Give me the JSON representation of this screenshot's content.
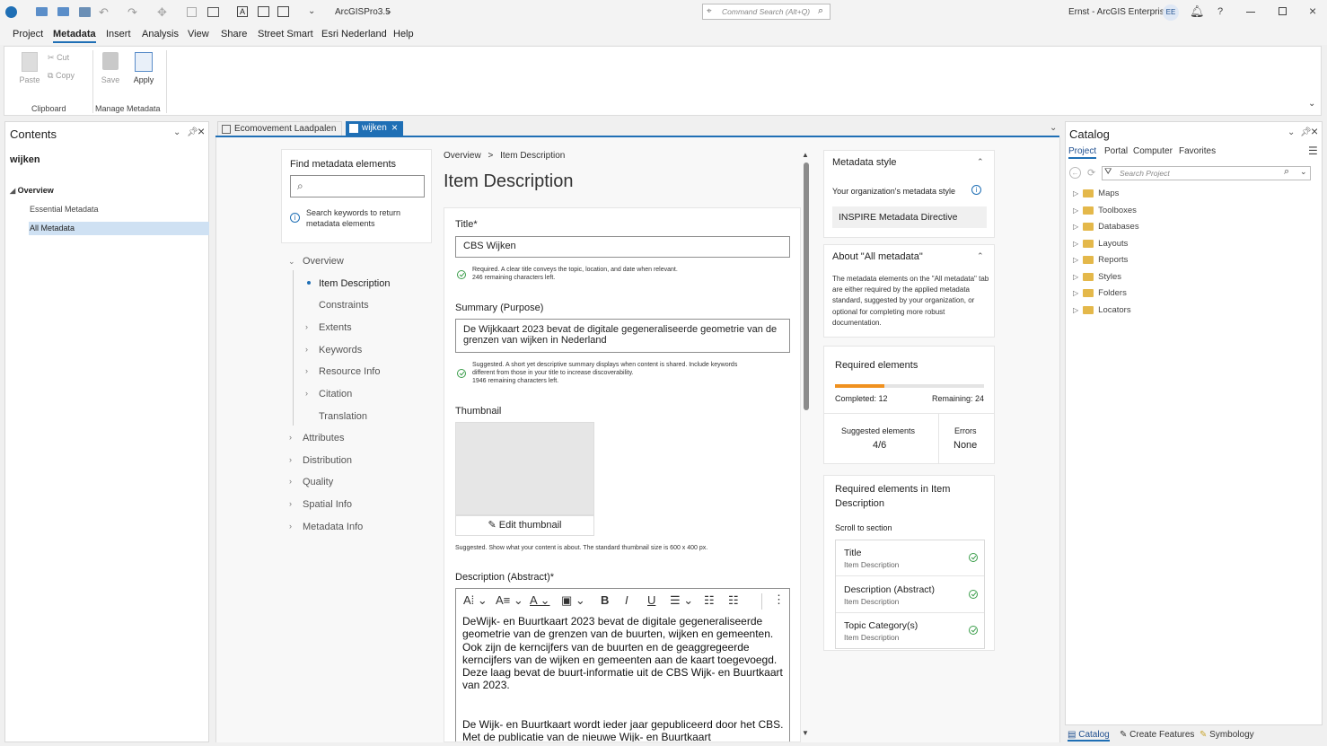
{
  "app": {
    "project_name": "ArcGISPro3.5",
    "command_search_placeholder": "Command Search (Alt+Q)",
    "user_portal": "Ernst - ArcGIS Enterprise",
    "user_initials": "EE",
    "help_symbol": "?"
  },
  "menu": [
    "Project",
    "Metadata",
    "Insert",
    "Analysis",
    "View",
    "Share",
    "Street Smart",
    "Esri Nederland",
    "Help"
  ],
  "ribbon": {
    "paste": "Paste",
    "cut": "Cut",
    "copy": "Copy",
    "clipboard_group": "Clipboard",
    "save": "Save",
    "apply": "Apply",
    "manage_group": "Manage Metadata"
  },
  "contents": {
    "title": "Contents",
    "layer": "wijken",
    "overview": "Overview",
    "essential": "Essential Metadata",
    "all": "All Metadata"
  },
  "tabs": [
    "Ecomovement Laadpalen",
    "wijken"
  ],
  "finder": {
    "title": "Find metadata elements",
    "search_hint": "Search keywords to return metadata elements"
  },
  "nav": {
    "overview": "Overview",
    "sub": [
      "Item Description",
      "Constraints",
      "Extents",
      "Keywords",
      "Resource Info",
      "Citation",
      "Translation"
    ],
    "top": [
      "Attributes",
      "Distribution",
      "Quality",
      "Spatial Info",
      "Metadata Info"
    ]
  },
  "breadcrumb": {
    "root": "Overview",
    "sep": ">",
    "current": "Item Description"
  },
  "page_title": "Item Description",
  "form": {
    "title_label": "Title*",
    "title_value": "CBS Wijken",
    "title_hint1": "Required. A clear title conveys the topic, location, and date when relevant.",
    "title_hint2": "246 remaining characters left.",
    "summary_label": "Summary (Purpose)",
    "summary_value": "De Wijkkaart 2023 bevat de digitale gegeneraliseerde geometrie van de grenzen van wijken  in Nederland",
    "summary_hint1": "Suggested. A short yet descriptive summary displays when content is shared. Include keywords",
    "summary_hint2": "different from those in your title to increase discoverability.",
    "summary_hint3": "1946 remaining characters left.",
    "thumbnail_label": "Thumbnail",
    "edit_thumbnail": "Edit thumbnail",
    "thumbnail_hint": "Suggested. Show what your content is about. The standard thumbnail size is 600 x 400 px.",
    "description_label": "Description (Abstract)*",
    "description_p1": "DeWijk- en Buurtkaart 2023 bevat de digitale gegeneraliseerde geometrie van de grenzen van de buurten, wijken en gemeenten. Ook zijn de kerncijfers van de buurten en de geaggregeerde kerncijfers van de wijken en gemeenten aan de kaart toegevoegd. Deze laag bevat de buurt-informatie uit de CBS Wijk- en Buurtkaart van 2023.",
    "description_p2": "De Wijk- en Buurtkaart wordt ieder jaar gepubliceerd door het CBS. Met de publicatie van de nieuwe Wijk- en Buurtkaart"
  },
  "side": {
    "style_title": "Metadata style",
    "style_org_label": "Your organization's metadata style",
    "style_value": "INSPIRE Metadata Directive",
    "about_title": "About \"All metadata\"",
    "about_text": "The metadata elements on the \"All metadata\" tab are either required by the applied metadata standard, suggested by your organization, or optional for completing more robust documentation.",
    "required_title": "Required elements",
    "completed": "Completed: 12",
    "remaining": "Remaining: 24",
    "progress_completed": 12,
    "progress_total": 36,
    "suggested_label": "Suggested elements",
    "suggested_value": "4/6",
    "errors_label": "Errors",
    "errors_value": "None",
    "req_item_title": "Required elements in Item Description",
    "scroll_label": "Scroll to section",
    "req_items": [
      {
        "name": "Title",
        "section": "Item Description"
      },
      {
        "name": "Description (Abstract)",
        "section": "Item Description"
      },
      {
        "name": "Topic Category(s)",
        "section": "Item Description"
      }
    ]
  },
  "catalog": {
    "title": "Catalog",
    "tabs": [
      "Project",
      "Portal",
      "Computer",
      "Favorites"
    ],
    "search_placeholder": "Search Project",
    "items": [
      "Maps",
      "Toolboxes",
      "Databases",
      "Layouts",
      "Reports",
      "Styles",
      "Folders",
      "Locators"
    ]
  },
  "statusbar": [
    "Catalog",
    "Create Features",
    "Symbology"
  ],
  "colors": {
    "accent": "#1f6fb5",
    "progress": "#f0911f",
    "check": "#3a9d4a"
  }
}
